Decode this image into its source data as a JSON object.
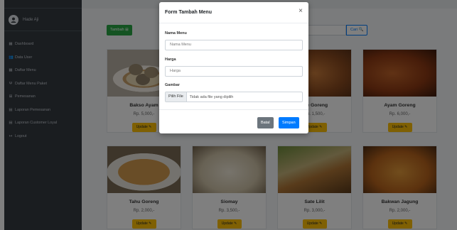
{
  "sidebar": {
    "username": "Hade Aji",
    "items": [
      {
        "icon": "dashboard-icon",
        "glyph": "▦",
        "label": "Dashboard"
      },
      {
        "icon": "users-icon",
        "glyph": "👥",
        "label": "Data User"
      },
      {
        "icon": "menu-list-icon",
        "glyph": "▦",
        "label": "Daftar Menu"
      },
      {
        "icon": "utensils-icon",
        "glyph": "Ψ",
        "label": "Daftar Menu Paket"
      },
      {
        "icon": "cart-icon",
        "glyph": "⊞",
        "label": "Pemesanan"
      },
      {
        "icon": "report-icon",
        "glyph": "▤",
        "label": "Laporan Pemesanan"
      },
      {
        "icon": "report-customer-icon",
        "glyph": "▤",
        "label": "Laporan Customer Loyal"
      },
      {
        "icon": "logout-icon",
        "glyph": "↦",
        "label": "Logout"
      }
    ]
  },
  "toolbar": {
    "add_label": "Tambah ⊞",
    "search_label": "Cari 🔍"
  },
  "cards": [
    {
      "name": "Bakso Ayam",
      "price": "Rp. 5,000,-",
      "button": "Update ✎"
    },
    {
      "name": "Mie Goreng",
      "price": "Rp. 1,500,-",
      "button": "Update ✎"
    },
    {
      "name": "Ayam Goreng",
      "price": "Rp. 6,000,-",
      "button": "Update ✎"
    },
    {
      "name": "Tahu Goreng",
      "price": "Rp. 2,000,-",
      "button": "Update ✎"
    },
    {
      "name": "Siomay",
      "price": "Rp. 3,500,-",
      "button": "Update ✎"
    },
    {
      "name": "Sate Lilit",
      "price": "Rp. 3,000,-",
      "button": "Update ✎"
    },
    {
      "name": "Bakwan Jagung",
      "price": "Rp. 2,000,-",
      "button": "Update ✎"
    }
  ],
  "modal": {
    "title": "Form Tambah Menu",
    "close": "×",
    "nama_label": "Nama Menu",
    "nama_placeholder": "Nama Menu",
    "harga_label": "Harga",
    "harga_placeholder": "Harga",
    "gambar_label": "Gambar",
    "file_button": "Pilih File",
    "file_status": "Tidak ada file yang dipilih",
    "batal": "Batal",
    "simpan": "Simpan"
  }
}
